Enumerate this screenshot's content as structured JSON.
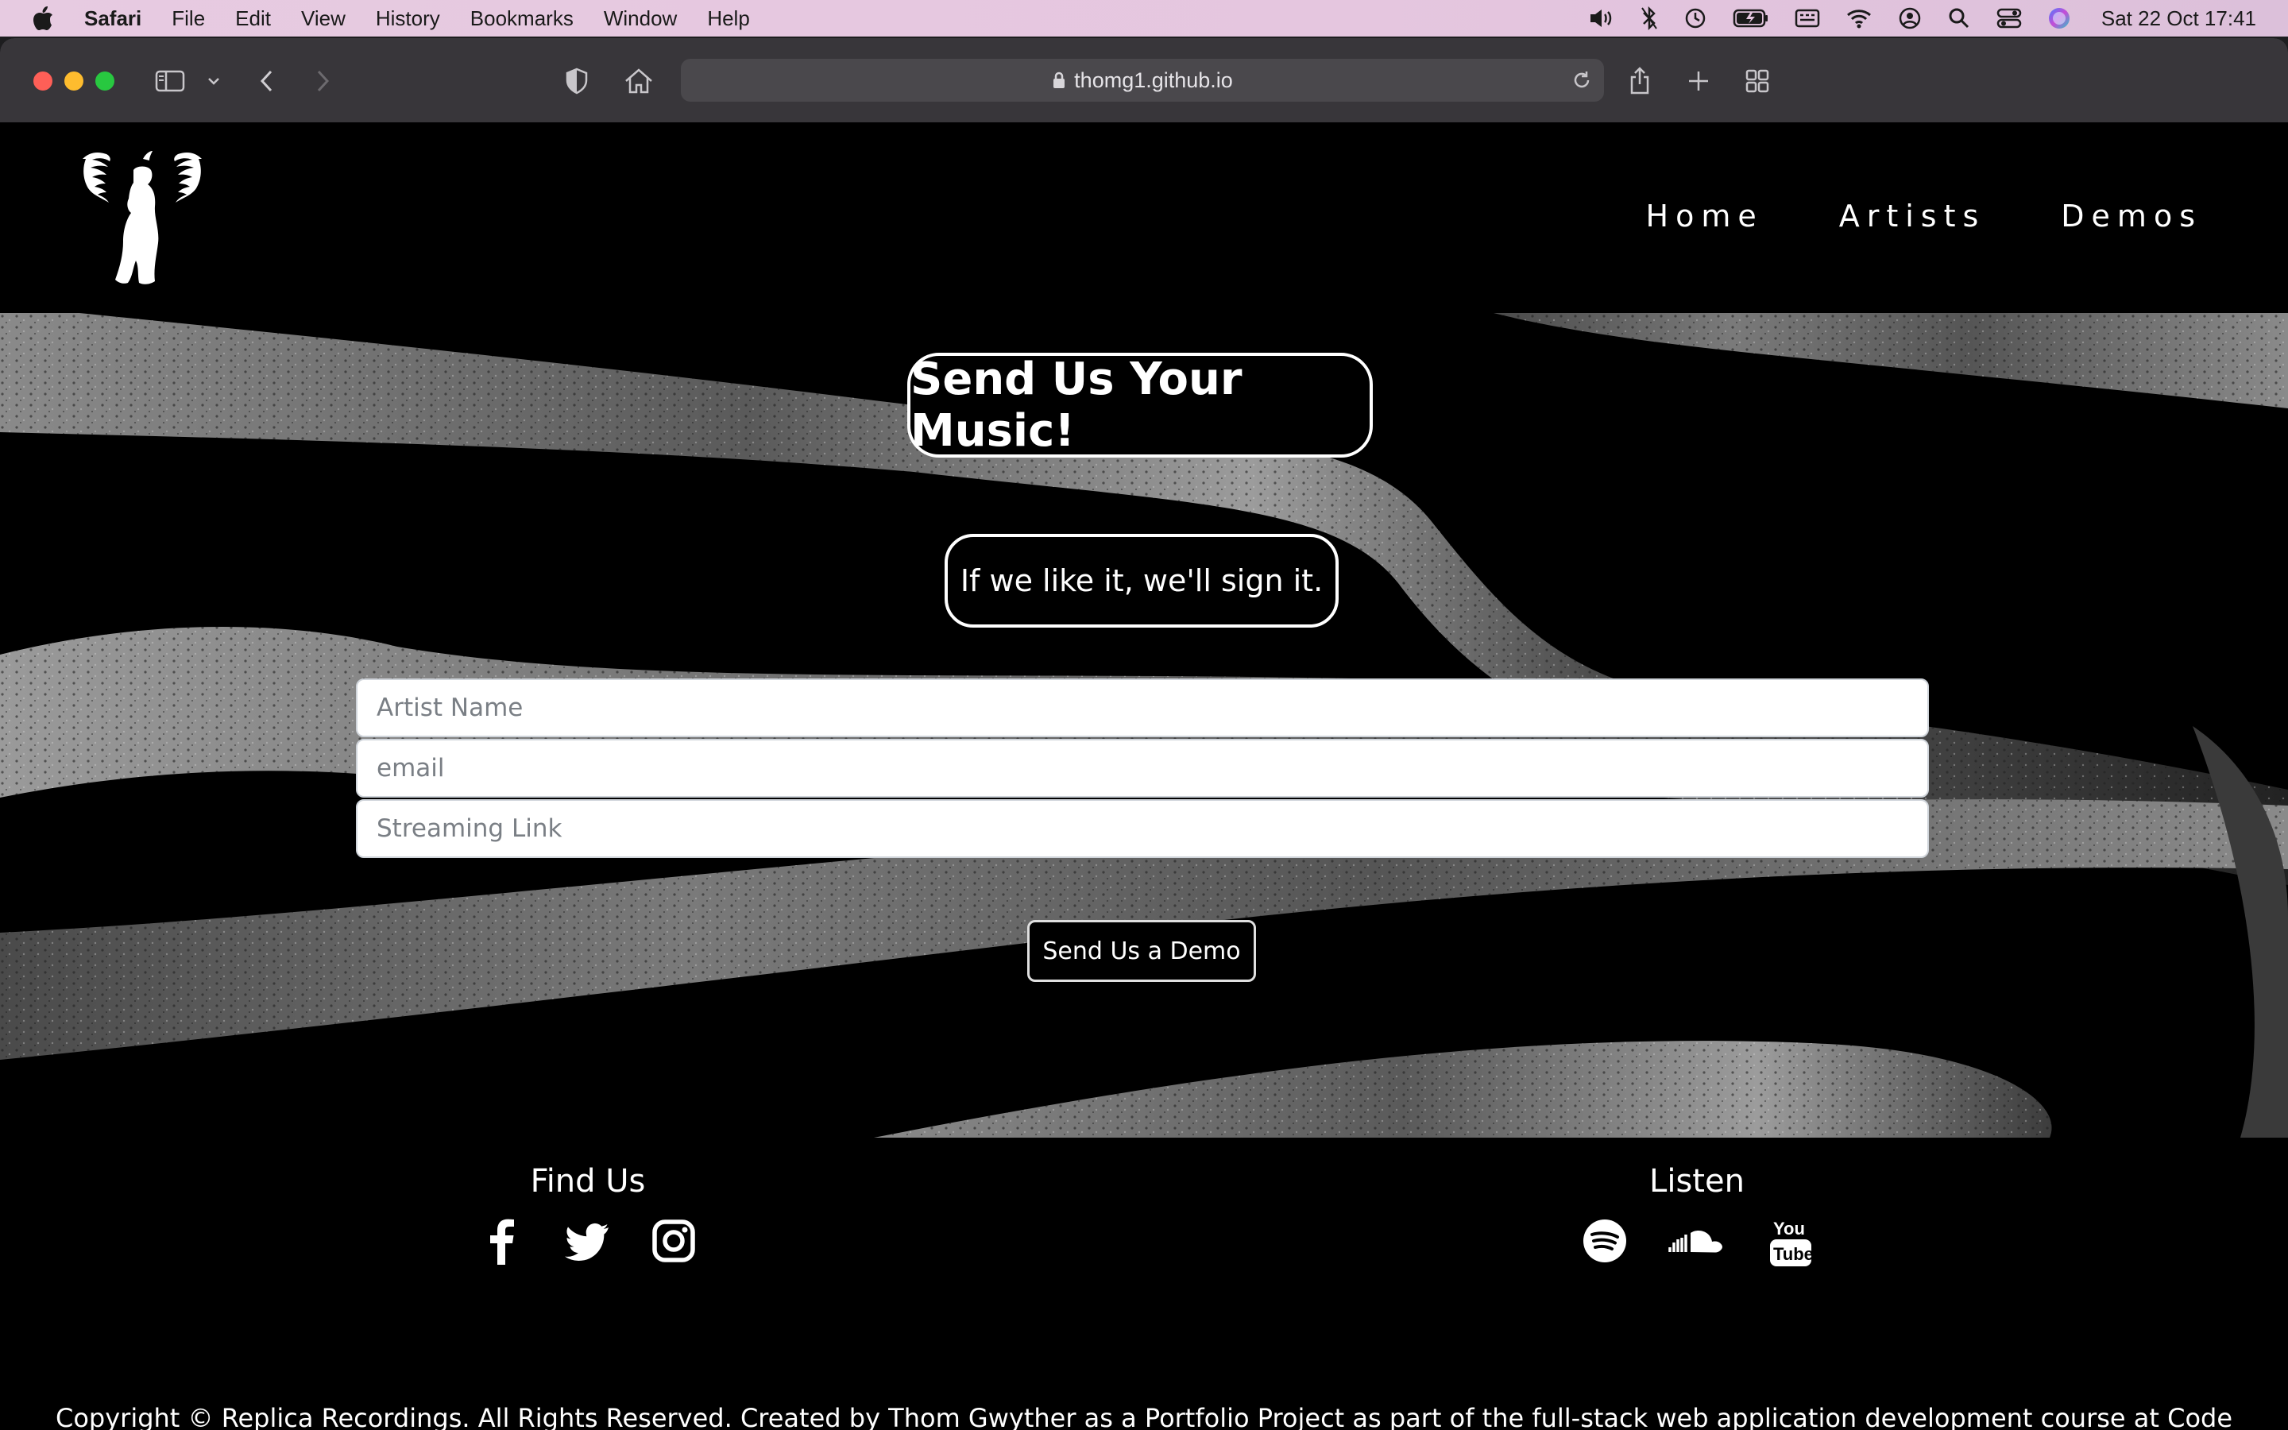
{
  "menubar": {
    "app": "Safari",
    "items": [
      "File",
      "Edit",
      "View",
      "History",
      "Bookmarks",
      "Window",
      "Help"
    ],
    "clock": "Sat 22 Oct  17:41"
  },
  "browser": {
    "url": "thomg1.github.io"
  },
  "nav": {
    "items": [
      "Home",
      "Artists",
      "Demos"
    ]
  },
  "hero": {
    "title": "Send Us Your Music!",
    "subtitle": "If we like it, we'll sign it."
  },
  "form": {
    "artist_placeholder": "Artist Name",
    "email_placeholder": "email",
    "link_placeholder": "Streaming Link",
    "submit_label": "Send Us a Demo"
  },
  "footer": {
    "find_heading": "Find Us",
    "listen_heading": "Listen",
    "find_icons": [
      "facebook-icon",
      "twitter-icon",
      "instagram-icon"
    ],
    "listen_icons": [
      "spotify-icon",
      "soundcloud-icon",
      "youtube-icon"
    ],
    "copyright": "Copyright © Replica Recordings. All Rights Reserved. Created by Thom Gwyther as a Portfolio Project as part of the full-stack web application development course at Code Institute"
  }
}
